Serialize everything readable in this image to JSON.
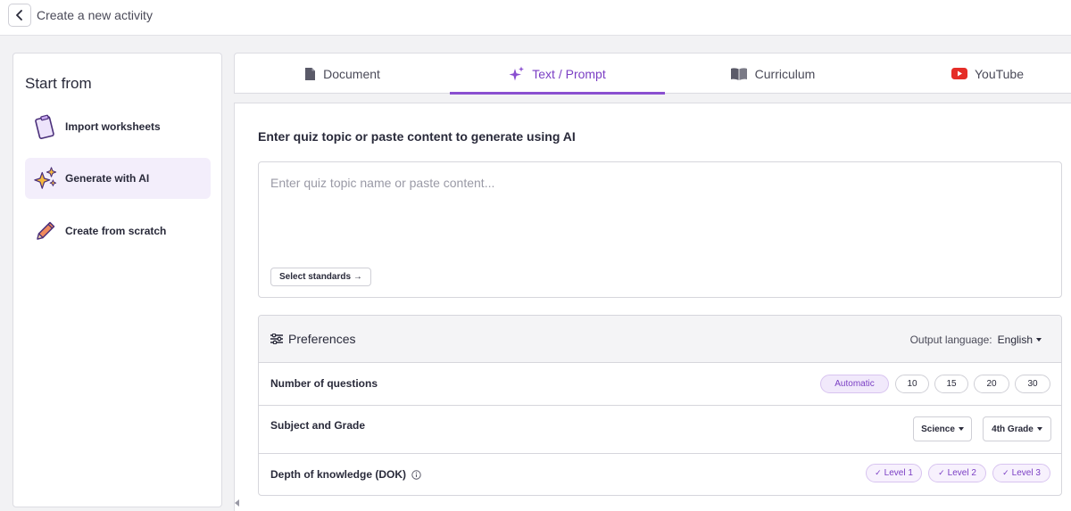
{
  "header": {
    "title": "Create a new activity"
  },
  "sidebar": {
    "heading": "Start from",
    "items": [
      {
        "label": "Import worksheets",
        "icon": "clipboard-icon"
      },
      {
        "label": "Generate with AI",
        "icon": "sparkles-icon",
        "active": true
      },
      {
        "label": "Create from scratch",
        "icon": "pencil-icon"
      }
    ]
  },
  "tabs": [
    {
      "label": "Document",
      "icon": "document-icon"
    },
    {
      "label": "Text / Prompt",
      "icon": "sparkle-icon",
      "active": true
    },
    {
      "label": "Curriculum",
      "icon": "book-icon"
    },
    {
      "label": "YouTube",
      "icon": "youtube-icon"
    }
  ],
  "main": {
    "heading": "Enter quiz topic or paste content to generate using AI",
    "prompt_placeholder": "Enter quiz topic name or paste content...",
    "prompt_value": "",
    "standards_button": "Select standards →"
  },
  "preferences": {
    "title": "Preferences",
    "output_language_label": "Output language:",
    "output_language_value": "English",
    "num_questions": {
      "label": "Number of questions",
      "options": [
        "Automatic",
        "10",
        "15",
        "20",
        "30"
      ],
      "selected": "Automatic"
    },
    "subject_grade": {
      "label": "Subject and Grade",
      "subject": "Science",
      "grade": "4th Grade"
    },
    "dok": {
      "label": "Depth of knowledge (DOK)",
      "levels": [
        "Level 1",
        "Level 2",
        "Level 3"
      ]
    }
  },
  "colors": {
    "accent": "#8a4fd0",
    "accent_bg": "#f3eefb",
    "youtube": "#e52d27"
  }
}
